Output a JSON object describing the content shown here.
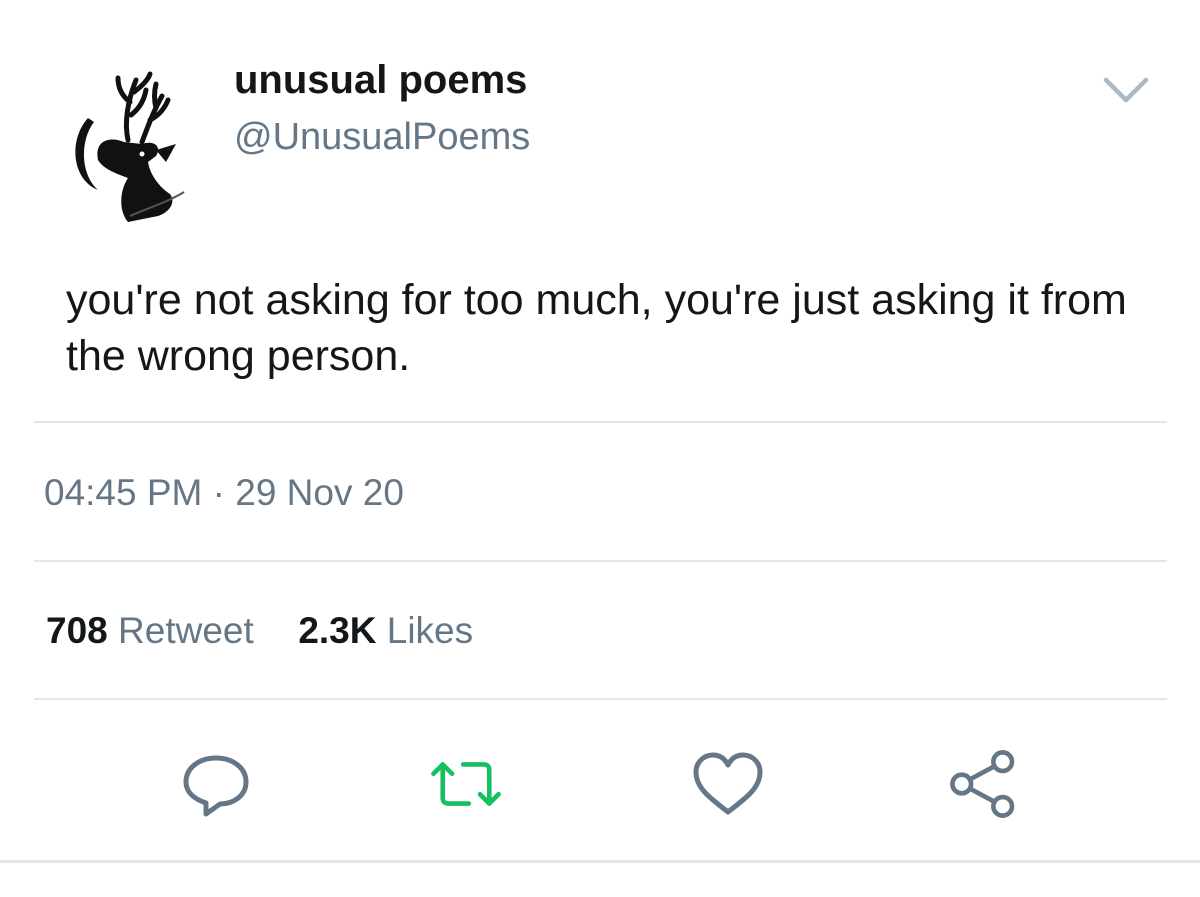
{
  "tweet": {
    "display_name": "unusual poems",
    "handle": "@UnusualPoems",
    "text": "you're not asking for too much, you're just asking it from the wrong person.",
    "timestamp": "04:45 PM · 29 Nov 20",
    "retweet_count": "708",
    "retweet_label": "Retweet",
    "like_count": "2.3K",
    "like_label": "Likes"
  },
  "icons": {
    "menu": "chevron-down-icon",
    "reply": "reply-icon",
    "retweet": "retweet-icon",
    "like": "heart-icon",
    "share": "share-icon"
  },
  "colors": {
    "text_primary": "#14171a",
    "text_secondary": "#657786",
    "retweet_accent": "#17bf63",
    "divider": "#e1e8ed"
  }
}
